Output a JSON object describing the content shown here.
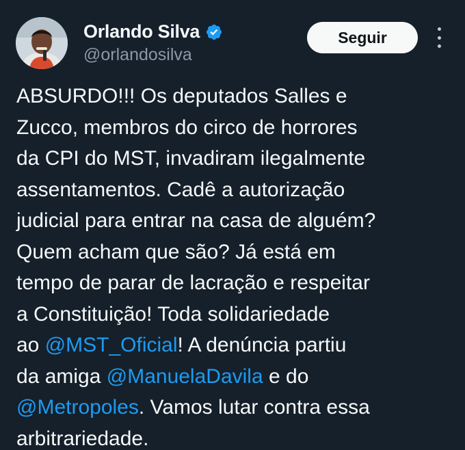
{
  "header": {
    "display_name": "Orlando Silva",
    "handle": "@orlandosilva",
    "follow_label": "Seguir",
    "verified_icon": "verified-badge-icon",
    "more_icon": "more-options-icon"
  },
  "tweet": {
    "lines": [
      [
        {
          "text": "ABSURDO!!! Os deputados Salles e"
        }
      ],
      [
        {
          "text": "Zucco, membros do circo de horrores"
        }
      ],
      [
        {
          "text": "da CPI do MST, invadiram ilegalmente"
        }
      ],
      [
        {
          "text": "assentamentos. Cadê a autorização"
        }
      ],
      [
        {
          "text": "judicial para entrar na casa de alguém?"
        }
      ],
      [
        {
          "text": "Quem acham que são? Já está em"
        }
      ],
      [
        {
          "text": "tempo de parar de lacração e respeitar"
        }
      ],
      [
        {
          "text": "a Constituição! Toda solidariedade"
        }
      ],
      [
        {
          "text": "ao "
        },
        {
          "text": "@MST_Oficial",
          "mention": true
        },
        {
          "text": "! A denúncia partiu"
        }
      ],
      [
        {
          "text": "da amiga "
        },
        {
          "text": "@ManuelaDavila",
          "mention": true
        },
        {
          "text": " e do"
        }
      ],
      [
        {
          "text": "@Metropoles",
          "mention": true
        },
        {
          "text": ". Vamos lutar contra essa"
        }
      ],
      [
        {
          "text": "arbitrariedade."
        }
      ]
    ]
  },
  "colors": {
    "background": "#15202b",
    "text": "#f7f9f9",
    "secondary_text": "#8b98a5",
    "accent": "#1d9bf0"
  }
}
